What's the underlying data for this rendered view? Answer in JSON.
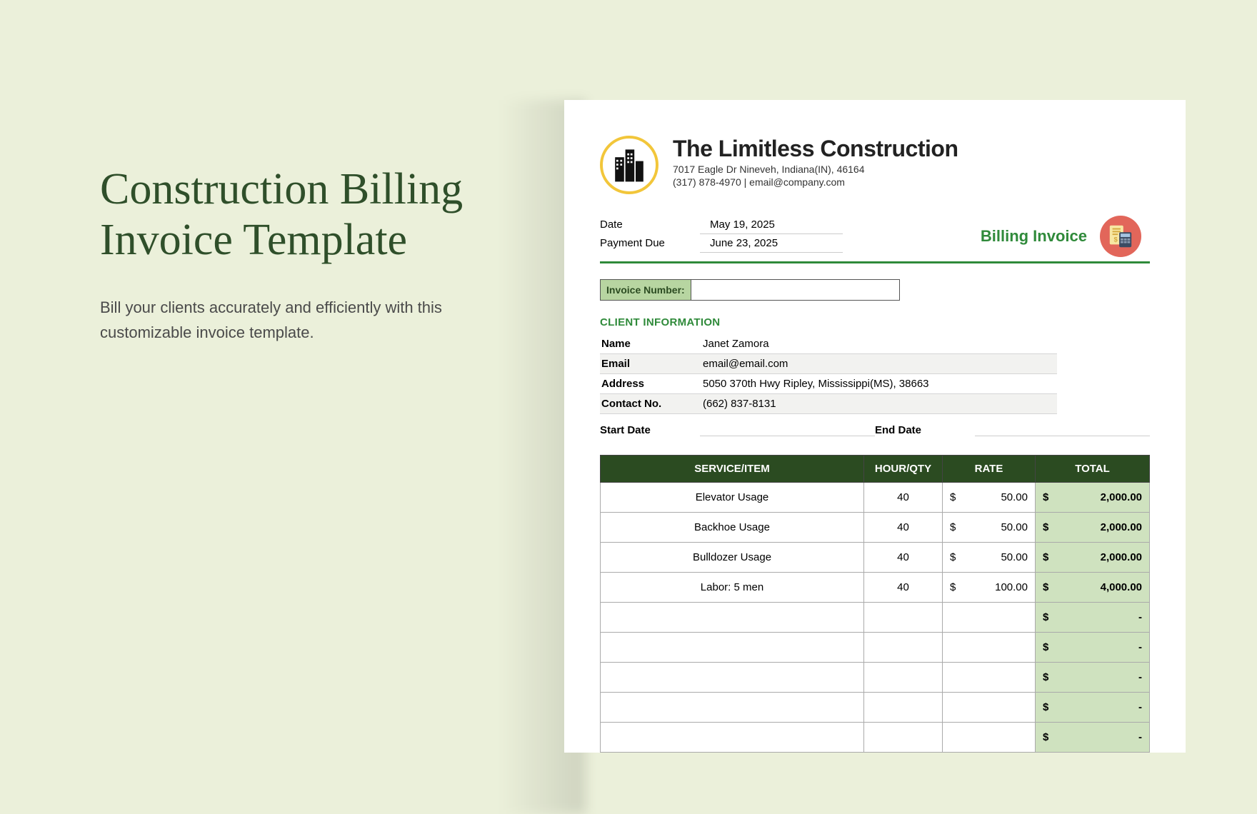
{
  "promo": {
    "title": "Construction Billing Invoice Template",
    "subtitle": "Bill your clients accurately and efficiently with this customizable invoice template."
  },
  "company": {
    "name": "The Limitless Construction",
    "address": "7017 Eagle Dr Nineveh, Indiana(IN), 46164",
    "phone": "(317) 878-4970",
    "email": "email@company.com"
  },
  "meta": {
    "date_label": "Date",
    "date_value": "May 19, 2025",
    "due_label": "Payment Due",
    "due_value": "June 23, 2025",
    "billing_label": "Billing Invoice",
    "invoice_number_label": "Invoice Number:",
    "invoice_number_value": ""
  },
  "client_section_title": "CLIENT INFORMATION",
  "client": {
    "name_label": "Name",
    "name_value": "Janet Zamora",
    "email_label": "Email",
    "email_value": "email@email.com",
    "address_label": "Address",
    "address_value": "5050 370th Hwy Ripley, Mississippi(MS), 38663",
    "contact_label": "Contact No.",
    "contact_value": "(662) 837-8131",
    "start_label": "Start Date",
    "start_value": "",
    "end_label": "End Date",
    "end_value": ""
  },
  "table": {
    "headers": {
      "service": "SERVICE/ITEM",
      "qty": "HOUR/QTY",
      "rate": "RATE",
      "total": "TOTAL"
    },
    "currency": "$",
    "dash": "-",
    "rows": [
      {
        "service": "Elevator Usage",
        "qty": "40",
        "rate": "50.00",
        "total": "2,000.00"
      },
      {
        "service": "Backhoe Usage",
        "qty": "40",
        "rate": "50.00",
        "total": "2,000.00"
      },
      {
        "service": "Bulldozer Usage",
        "qty": "40",
        "rate": "50.00",
        "total": "2,000.00"
      },
      {
        "service": "Labor: 5 men",
        "qty": "40",
        "rate": "100.00",
        "total": "4,000.00"
      },
      {
        "service": "",
        "qty": "",
        "rate": "",
        "total": ""
      },
      {
        "service": "",
        "qty": "",
        "rate": "",
        "total": ""
      },
      {
        "service": "",
        "qty": "",
        "rate": "",
        "total": ""
      },
      {
        "service": "",
        "qty": "",
        "rate": "",
        "total": ""
      },
      {
        "service": "",
        "qty": "",
        "rate": "",
        "total": ""
      }
    ]
  }
}
